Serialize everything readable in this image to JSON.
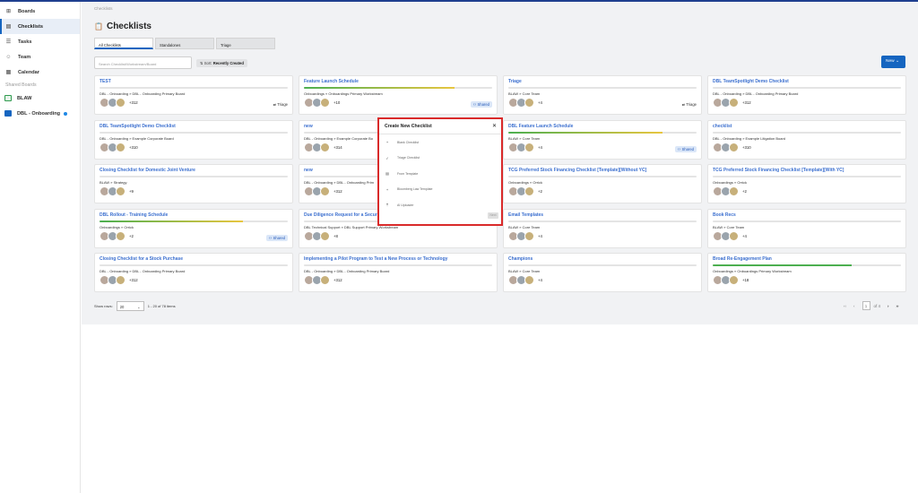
{
  "sidebar": {
    "items": [
      {
        "icon": "grid-icon",
        "label": "Boards"
      },
      {
        "icon": "clipboard-icon",
        "label": "Checklists"
      },
      {
        "icon": "list-icon",
        "label": "Tasks"
      },
      {
        "icon": "people-icon",
        "label": "Team"
      },
      {
        "icon": "calendar-icon",
        "label": "Calendar"
      }
    ],
    "shared_heading": "Shared Boards",
    "boards": [
      "BLAW",
      "DBL - Onboarding"
    ]
  },
  "header": {
    "breadcrumb": "Checklists",
    "title": "Checklists"
  },
  "tabs": [
    "All Checklists",
    "Standalones",
    "Triage"
  ],
  "search": {
    "placeholder": "Search Checklist/Workstream/Board"
  },
  "sort": {
    "prefix": "Sort:",
    "value": "Recently Created"
  },
  "new_button": "New",
  "cards": [
    {
      "title": "TEST",
      "sub": "DBL - Onboarding » DBL - Onboarding Primary Board",
      "count": "+312",
      "tag": "Triage",
      "shared": "",
      "progress": 0,
      "color": ""
    },
    {
      "title": "Feature Launch Schedule",
      "sub": "Onboardings » Onboardings Primary Workstream",
      "count": "+10",
      "tag": "",
      "shared": "Shared",
      "progress": 0.8,
      "color": "grad"
    },
    {
      "title": "Triage",
      "sub": "BLAW » Core Team",
      "count": "+4",
      "tag": "Triage",
      "shared": "",
      "progress": 0,
      "color": ""
    },
    {
      "title": "DBL TeamSpotlight Demo Checklist",
      "sub": "DBL - Onboarding » DBL - Onboarding Primary Board",
      "count": "+312",
      "tag": "",
      "shared": "",
      "progress": 0,
      "color": ""
    },
    {
      "title": "DBL TeamSpotlight Demo Checklist",
      "sub": "DBL - Onboarding » Example Corporate Board",
      "count": "+310",
      "tag": "",
      "shared": "",
      "progress": 0,
      "color": ""
    },
    {
      "title": "new",
      "sub": "DBL - Onboarding » Example Corporate Bo",
      "count": "+314",
      "tag": "",
      "shared": "",
      "progress": 0,
      "color": ""
    },
    {
      "title": "DBL Feature Launch Schedule",
      "sub": "BLAW » Core Team",
      "count": "+4",
      "tag": "",
      "shared": "Shared",
      "progress": 0.82,
      "color": "grad"
    },
    {
      "title": "checklist",
      "sub": "DBL - Onboarding » Example Litigation Board",
      "count": "+310",
      "tag": "",
      "shared": "",
      "progress": 0,
      "color": ""
    },
    {
      "title": "Closing Checklist for Domestic Joint Venture",
      "sub": "BLAW » Strategy",
      "count": "+9",
      "tag": "",
      "shared": "",
      "progress": 0,
      "color": ""
    },
    {
      "title": "new",
      "sub": "DBL - Onboarding » DBL - Onboarding Prim",
      "count": "+312",
      "tag": "",
      "shared": "",
      "progress": 0,
      "color": ""
    },
    {
      "title": "TCG Preferred Stock Financing Checklist [Template][Without YC]",
      "sub": "Onboardings » Orrick",
      "count": "+2",
      "tag": "",
      "shared": "",
      "progress": 0,
      "color": ""
    },
    {
      "title": "TCG Preferred Stock Financing Checklist [Template][With YC]",
      "sub": "Onboardings » Orrick",
      "count": "+2",
      "tag": "",
      "shared": "",
      "progress": 0,
      "color": ""
    },
    {
      "title": "DBL Rollout - Training Schedule",
      "sub": "Onboardings » Orrick",
      "count": "+2",
      "tag": "",
      "shared": "Shared",
      "progress": 0.76,
      "color": "grad"
    },
    {
      "title": "Due Diligence Request for a Securiti",
      "sub": "DBL Technical Support » DBL Support Primary Workstream",
      "count": "+8",
      "tag": "",
      "shared": "",
      "progress": 0,
      "color": ""
    },
    {
      "title": "Email Templates",
      "sub": "BLAW » Core Team",
      "count": "+4",
      "tag": "",
      "shared": "",
      "progress": 0,
      "color": ""
    },
    {
      "title": "Book Recs",
      "sub": "BLAW » Core Team",
      "count": "+4",
      "tag": "",
      "shared": "",
      "progress": 0,
      "color": ""
    },
    {
      "title": "Closing Checklist for a Stock Purchase",
      "sub": "DBL - Onboarding » DBL - Onboarding Primary Board",
      "count": "+312",
      "tag": "",
      "shared": "",
      "progress": 0,
      "color": ""
    },
    {
      "title": "Implementing a Pilot Program to Test a New Process or Technology",
      "sub": "DBL - Onboarding » DBL - Onboarding Primary Board",
      "count": "+312",
      "tag": "",
      "shared": "",
      "progress": 0,
      "color": ""
    },
    {
      "title": "Champions",
      "sub": "BLAW » Core Team",
      "count": "+4",
      "tag": "",
      "shared": "",
      "progress": 0,
      "color": ""
    },
    {
      "title": "Broad Re-Engagement Plan",
      "sub": "Onboardings » Onboardings Primary Workstream",
      "count": "+18",
      "tag": "",
      "shared": "",
      "progress": 0.74,
      "color": "green"
    }
  ],
  "footer": {
    "show_rows": "Show rows:",
    "rows_value": "20",
    "range": "1 - 20 of 78 items",
    "page": "1",
    "of_pages": "of 4"
  },
  "modal": {
    "title": "Create New Checklist",
    "options": [
      {
        "icon": "plus-icon",
        "label": "Blank Checklist"
      },
      {
        "icon": "check-icon",
        "label": "Triage Checklist"
      },
      {
        "icon": "template-icon",
        "label": "From Template"
      },
      {
        "icon": "plus-icon",
        "label": "Bloomberg Law Template"
      },
      {
        "icon": "upload-icon",
        "label": "AI Uploader"
      }
    ],
    "next": "Next"
  },
  "colors": {
    "accent": "#1565c0",
    "link": "#3b6fcf",
    "highlight": "#d92a2a",
    "progress_green": "#4caf50",
    "progress_yellow": "#e8c640"
  }
}
